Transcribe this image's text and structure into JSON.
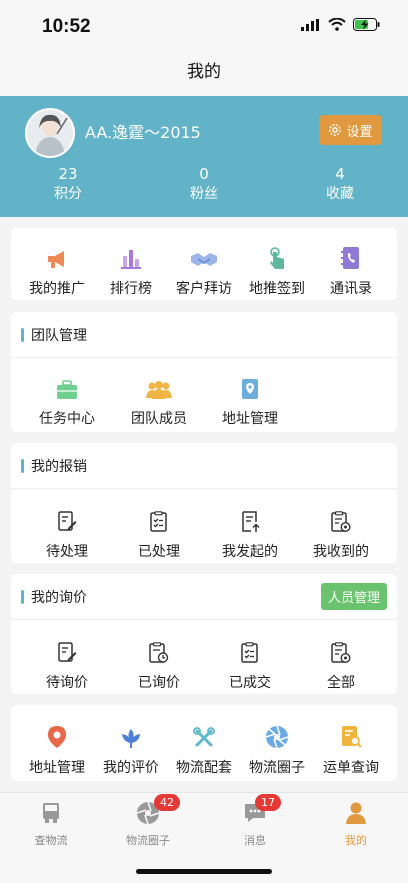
{
  "status": {
    "time": "10:52"
  },
  "nav": {
    "title": "我的"
  },
  "profile": {
    "username": "AA.逸霆～2015",
    "settings_label": "设置",
    "stats": [
      {
        "value": "23",
        "label": "积分"
      },
      {
        "value": "0",
        "label": "粉丝"
      },
      {
        "value": "4",
        "label": "收藏"
      }
    ]
  },
  "quick": [
    {
      "label": "我的推广",
      "icon": "megaphone-icon",
      "color": "#ee8a55"
    },
    {
      "label": "排行榜",
      "icon": "ranking-bars-icon",
      "color": "#a878d6"
    },
    {
      "label": "客户拜访",
      "icon": "handshake-icon",
      "color": "#6e93d8"
    },
    {
      "label": "地推签到",
      "icon": "tap-hand-icon",
      "color": "#5fb89a"
    },
    {
      "label": "通讯录",
      "icon": "phonebook-icon",
      "color": "#8f7ad8"
    }
  ],
  "team": {
    "title": "团队管理",
    "items": [
      {
        "label": "任务中心",
        "icon": "briefcase-icon",
        "color": "#6fcf8e"
      },
      {
        "label": "团队成员",
        "icon": "group-icon",
        "color": "#f0b544"
      },
      {
        "label": "地址管理",
        "icon": "map-pin-doc-icon",
        "color": "#6eaede"
      }
    ]
  },
  "reimburse": {
    "title": "我的报销",
    "items": [
      {
        "label": "待处理",
        "icon": "doc-edit-icon"
      },
      {
        "label": "已处理",
        "icon": "doc-check-icon"
      },
      {
        "label": "我发起的",
        "icon": "doc-upload-icon"
      },
      {
        "label": "我收到的",
        "icon": "doc-gear-icon"
      }
    ]
  },
  "inquiry": {
    "title": "我的询价",
    "manage_label": "人员管理",
    "items": [
      {
        "label": "待询价",
        "icon": "doc-edit-icon"
      },
      {
        "label": "已询价",
        "icon": "doc-clock-icon"
      },
      {
        "label": "已成交",
        "icon": "doc-check-icon"
      },
      {
        "label": "全部",
        "icon": "doc-gear-icon"
      }
    ]
  },
  "services": [
    {
      "label": "地址管理",
      "icon": "location-pin-icon",
      "color": "#e8674a"
    },
    {
      "label": "我的评价",
      "icon": "lotus-icon",
      "color": "#4d7fd8"
    },
    {
      "label": "物流配套",
      "icon": "tools-icon",
      "color": "#5fb9c9"
    },
    {
      "label": "物流圈子",
      "icon": "aperture-icon",
      "color": "#6aa9e6"
    },
    {
      "label": "运单查询",
      "icon": "doc-search-icon",
      "color": "#efb53c"
    }
  ],
  "tabs": [
    {
      "label": "查物流",
      "icon": "truck-icon",
      "badge": ""
    },
    {
      "label": "物流圈子",
      "icon": "aperture-icon",
      "badge": "42"
    },
    {
      "label": "消息",
      "icon": "chat-icon",
      "badge": "17"
    },
    {
      "label": "我的",
      "icon": "person-icon",
      "badge": ""
    }
  ],
  "colors": {
    "accent": "#62b3c7",
    "orange": "#e0993f",
    "green": "#6cc36f",
    "badge": "#e53935"
  }
}
